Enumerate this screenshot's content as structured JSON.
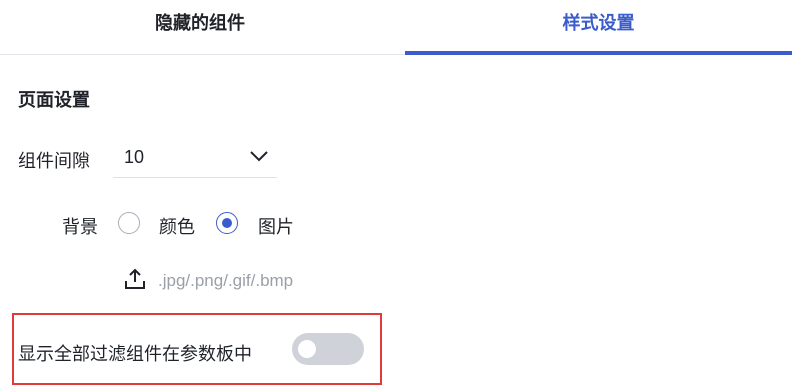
{
  "tabs": {
    "hidden_components": "隐藏的组件",
    "style_settings": "样式设置",
    "active": "style_settings"
  },
  "page_settings": {
    "title": "页面设置",
    "component_gap": {
      "label": "组件间隙",
      "value": "10"
    },
    "background": {
      "label": "背景",
      "options": [
        "颜色",
        "图片"
      ],
      "selected": "图片"
    },
    "upload": {
      "icon": "upload-icon",
      "hint": ".jpg/.png/.gif/.bmp"
    },
    "show_all_filters": {
      "label": "显示全部过滤组件在参数板中",
      "enabled": false
    }
  },
  "colors": {
    "accent": "#3b5ccc",
    "highlight": "#e03b3b",
    "toggle_off": "#cfd2d9"
  }
}
